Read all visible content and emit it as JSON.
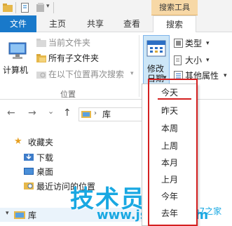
{
  "contextual_tab_header": "搜索工具",
  "tabs": [
    "文件",
    "主页",
    "共享",
    "查看",
    "搜索"
  ],
  "ribbon": {
    "computer_label": "计算机",
    "current_folder": "当前文件夹",
    "all_subfolders": "所有子文件夹",
    "search_again_in": "在以下位置再次搜索",
    "location_group": "位置",
    "modified_date": [
      "修改",
      "日期"
    ],
    "type_label": "类型",
    "size_label": "大小",
    "other_props": "其他属性"
  },
  "nav": {
    "address_text": "库",
    "back": "←",
    "forward": "→",
    "up": "↑",
    "recent": "⌄"
  },
  "tree": {
    "favorites": "收藏夹",
    "downloads": "下载",
    "desktop": "桌面",
    "recent_places": "最近访问的位置",
    "libraries": "库"
  },
  "date_menu": [
    "今天",
    "昨天",
    "本周",
    "上周",
    "本月",
    "上月",
    "今年",
    "去年"
  ],
  "watermark": {
    "brand": "技术员联盟",
    "url": "www.jsgho.com",
    "sub": "Win7之家"
  },
  "colors": {
    "file_tab": "#1979ca",
    "contextual_tab": "#f7d8a6",
    "highlight": "#d42020",
    "watermark": "#19a8e2"
  }
}
